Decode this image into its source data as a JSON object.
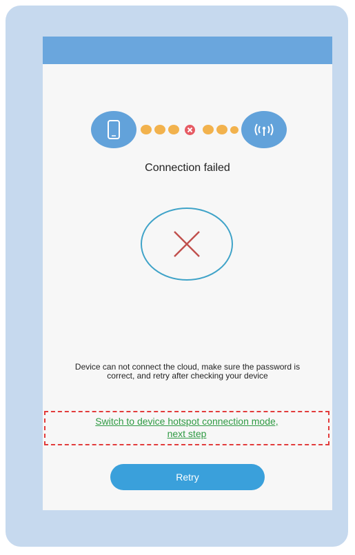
{
  "screen": {
    "status_title": "Connection failed",
    "message": "Device can not connect the cloud, make sure the password is correct, and retry after checking your device",
    "hotspot_link_line1": "Switch to device hotspot connection mode,",
    "hotspot_link_line2": "next step",
    "retry_label": "Retry"
  },
  "icons": {
    "left_endpoint": "phone-icon",
    "right_endpoint": "wifi-signal-icon",
    "link_status": "error-x-icon",
    "result": "fail-x-icon"
  },
  "colors": {
    "frame": "#c6d9ee",
    "header": "#6aa6dd",
    "endpoint": "#62a2da",
    "progress_dot": "#f2b24d",
    "error_dot": "#e65b64",
    "fail_x": "#c0504d",
    "ring": "#3fa3c8",
    "link": "#2f9a43",
    "highlight_box": "#e23b3b",
    "button": "#3aa0db"
  }
}
